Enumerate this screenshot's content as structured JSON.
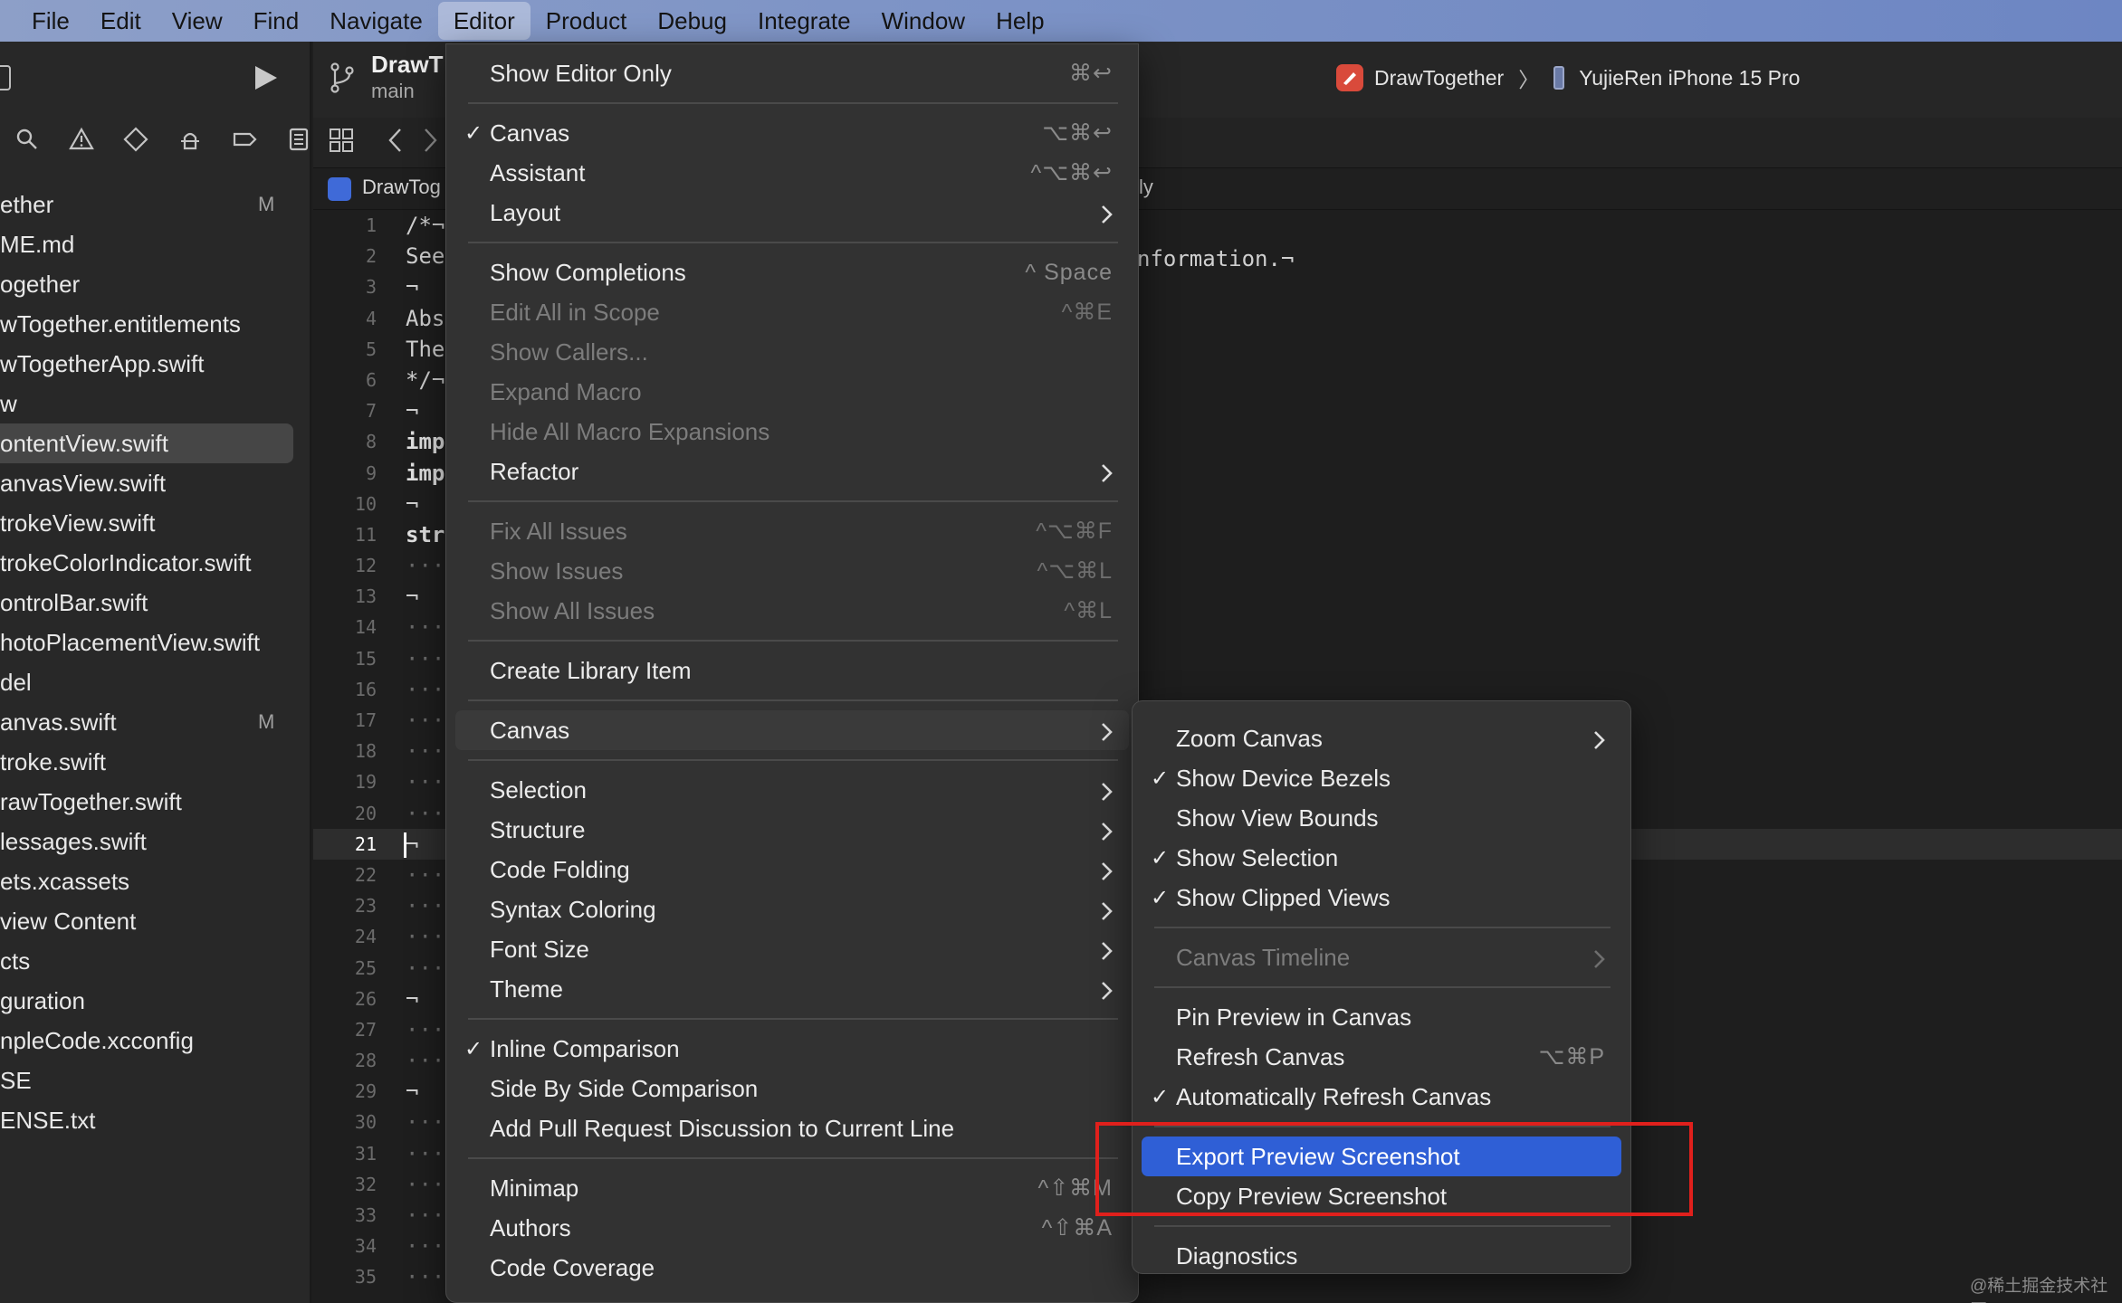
{
  "menubar": {
    "items": [
      "File",
      "Edit",
      "View",
      "Find",
      "Navigate",
      "Editor",
      "Product",
      "Debug",
      "Integrate",
      "Window",
      "Help"
    ],
    "active": "Editor"
  },
  "sidebar": {
    "files": [
      {
        "name": "ether",
        "badge": "M"
      },
      {
        "name": "ME.md",
        "badge": ""
      },
      {
        "name": "ogether",
        "badge": ""
      },
      {
        "name": "wTogether.entitlements",
        "badge": ""
      },
      {
        "name": "wTogetherApp.swift",
        "badge": ""
      },
      {
        "name": "w",
        "badge": ""
      },
      {
        "name": "ontentView.swift",
        "badge": "",
        "selected": true
      },
      {
        "name": "anvasView.swift",
        "badge": ""
      },
      {
        "name": "trokeView.swift",
        "badge": ""
      },
      {
        "name": "trokeColorIndicator.swift",
        "badge": ""
      },
      {
        "name": "ontrolBar.swift",
        "badge": ""
      },
      {
        "name": "hotoPlacementView.swift",
        "badge": ""
      },
      {
        "name": "del",
        "badge": ""
      },
      {
        "name": "anvas.swift",
        "badge": "M"
      },
      {
        "name": "troke.swift",
        "badge": ""
      },
      {
        "name": "rawTogether.swift",
        "badge": ""
      },
      {
        "name": "lessages.swift",
        "badge": ""
      },
      {
        "name": "ets.xcassets",
        "badge": ""
      },
      {
        "name": "view Content",
        "badge": ""
      },
      {
        "name": "cts",
        "badge": ""
      },
      {
        "name": "guration",
        "badge": ""
      },
      {
        "name": "npleCode.xcconfig",
        "badge": ""
      },
      {
        "name": "SE",
        "badge": ""
      },
      {
        "name": "ENSE.txt",
        "badge": ""
      }
    ]
  },
  "toolbar": {
    "project_title": "DrawT",
    "branch": "main",
    "scheme": "DrawTogether",
    "scheme_separator": "〉",
    "device": "YujieRen iPhone 15 Pro"
  },
  "tab": {
    "label": "DrawTog",
    "tail": "ly"
  },
  "editor": {
    "current_line": 21,
    "lines": [
      "/*¬",
      "See",
      "¬",
      "Abs",
      "The",
      "*/¬",
      "¬",
      "imp",
      "imp",
      "¬",
      "str",
      "···",
      "¬",
      "···",
      "···",
      "···",
      "···",
      "···",
      "···",
      "···",
      "¬",
      "···",
      "···",
      "···",
      "···",
      "¬",
      "···",
      "···",
      "¬",
      "···",
      "···",
      "···",
      "···",
      "···",
      "···"
    ],
    "line2_tail": "nformation.¬"
  },
  "editor_menu": {
    "items": [
      {
        "label": "Show Editor Only",
        "shortcut": "⌘↩",
        "checked": false,
        "disabled": false,
        "submenu": false
      },
      {
        "label": "Canvas",
        "shortcut": "⌥⌘↩",
        "checked": true,
        "disabled": false,
        "submenu": false
      },
      {
        "label": "Assistant",
        "shortcut": "^⌥⌘↩",
        "checked": false,
        "disabled": false,
        "submenu": false
      },
      {
        "label": "Layout",
        "shortcut": "",
        "checked": false,
        "disabled": false,
        "submenu": true
      },
      {
        "label": "Show Completions",
        "shortcut": "^ Space",
        "checked": false,
        "disabled": false,
        "submenu": false
      },
      {
        "label": "Edit All in Scope",
        "shortcut": "^⌘E",
        "checked": false,
        "disabled": true,
        "submenu": false
      },
      {
        "label": "Show Callers...",
        "shortcut": "",
        "checked": false,
        "disabled": true,
        "submenu": false
      },
      {
        "label": "Expand Macro",
        "shortcut": "",
        "checked": false,
        "disabled": true,
        "submenu": false
      },
      {
        "label": "Hide All Macro Expansions",
        "shortcut": "",
        "checked": false,
        "disabled": true,
        "submenu": false
      },
      {
        "label": "Refactor",
        "shortcut": "",
        "checked": false,
        "disabled": false,
        "submenu": true
      },
      {
        "label": "Fix All Issues",
        "shortcut": "^⌥⌘F",
        "checked": false,
        "disabled": true,
        "submenu": false
      },
      {
        "label": "Show Issues",
        "shortcut": "^⌥⌘L",
        "checked": false,
        "disabled": true,
        "submenu": false
      },
      {
        "label": "Show All Issues",
        "shortcut": "^⌘L",
        "checked": false,
        "disabled": true,
        "submenu": false
      },
      {
        "label": "Create Library Item",
        "shortcut": "",
        "checked": false,
        "disabled": false,
        "submenu": false
      },
      {
        "label": "Canvas",
        "shortcut": "",
        "checked": false,
        "disabled": false,
        "submenu": true,
        "highlighted": true
      },
      {
        "label": "Selection",
        "shortcut": "",
        "checked": false,
        "disabled": false,
        "submenu": true
      },
      {
        "label": "Structure",
        "shortcut": "",
        "checked": false,
        "disabled": false,
        "submenu": true
      },
      {
        "label": "Code Folding",
        "shortcut": "",
        "checked": false,
        "disabled": false,
        "submenu": true
      },
      {
        "label": "Syntax Coloring",
        "shortcut": "",
        "checked": false,
        "disabled": false,
        "submenu": true
      },
      {
        "label": "Font Size",
        "shortcut": "",
        "checked": false,
        "disabled": false,
        "submenu": true
      },
      {
        "label": "Theme",
        "shortcut": "",
        "checked": false,
        "disabled": false,
        "submenu": true
      },
      {
        "label": "Inline Comparison",
        "shortcut": "",
        "checked": true,
        "disabled": false,
        "submenu": false
      },
      {
        "label": "Side By Side Comparison",
        "shortcut": "",
        "checked": false,
        "disabled": false,
        "submenu": false
      },
      {
        "label": "Add Pull Request Discussion to Current Line",
        "shortcut": "",
        "checked": false,
        "disabled": false,
        "submenu": false
      },
      {
        "label": "Minimap",
        "shortcut": "^⇧⌘M",
        "checked": false,
        "disabled": false,
        "submenu": false
      },
      {
        "label": "Authors",
        "shortcut": "^⇧⌘A",
        "checked": false,
        "disabled": false,
        "submenu": false
      },
      {
        "label": "Code Coverage",
        "shortcut": "",
        "checked": false,
        "disabled": false,
        "submenu": false
      }
    ]
  },
  "canvas_menu": {
    "items": [
      {
        "label": "Zoom Canvas",
        "shortcut": "",
        "checked": false,
        "disabled": false,
        "submenu": true
      },
      {
        "label": "Show Device Bezels",
        "shortcut": "",
        "checked": true,
        "disabled": false,
        "submenu": false
      },
      {
        "label": "Show View Bounds",
        "shortcut": "",
        "checked": false,
        "disabled": false,
        "submenu": false
      },
      {
        "label": "Show Selection",
        "shortcut": "",
        "checked": true,
        "disabled": false,
        "submenu": false
      },
      {
        "label": "Show Clipped Views",
        "shortcut": "",
        "checked": true,
        "disabled": false,
        "submenu": false
      },
      {
        "label": "Canvas Timeline",
        "shortcut": "",
        "checked": false,
        "disabled": true,
        "submenu": true
      },
      {
        "label": "Pin Preview in Canvas",
        "shortcut": "",
        "checked": false,
        "disabled": false,
        "submenu": false
      },
      {
        "label": "Refresh Canvas",
        "shortcut": "⌥⌘P",
        "checked": false,
        "disabled": false,
        "submenu": false
      },
      {
        "label": "Automatically Refresh Canvas",
        "shortcut": "",
        "checked": true,
        "disabled": false,
        "submenu": false
      },
      {
        "label": "Export Preview Screenshot",
        "shortcut": "",
        "checked": false,
        "disabled": false,
        "submenu": false,
        "selected": true
      },
      {
        "label": "Copy Preview Screenshot",
        "shortcut": "",
        "checked": false,
        "disabled": false,
        "submenu": false
      },
      {
        "label": "Diagnostics",
        "shortcut": "",
        "checked": false,
        "disabled": false,
        "submenu": false
      }
    ]
  },
  "colors": {
    "selection_blue": "#2f5fd6",
    "annotation_red": "#e0201c",
    "menubar": "#7e94c6"
  },
  "watermark": "@稀土掘金技术社区"
}
